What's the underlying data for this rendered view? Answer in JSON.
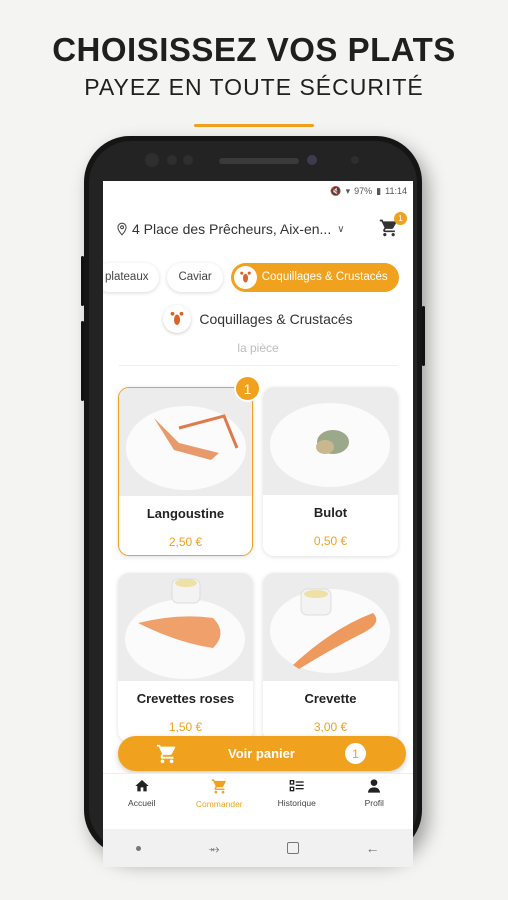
{
  "promo": {
    "headline": "CHOISISSEZ VOS PLATS",
    "subheadline": "PAYEZ EN TOUTE SÉCURITÉ"
  },
  "status_bar": {
    "battery": "97%",
    "time": "11:14"
  },
  "location": {
    "address": "4 Place des Prêcheurs, Aix-en...",
    "icon": "map-pin-icon"
  },
  "header_cart": {
    "count": "1",
    "icon": "cart-icon"
  },
  "categories": [
    {
      "label": "plateaux",
      "active": false
    },
    {
      "label": "Caviar",
      "active": false
    },
    {
      "label": "Coquillages & Crustacés",
      "active": true
    }
  ],
  "section": {
    "title": "Coquillages & Crustacés",
    "subtitle": "la pièce"
  },
  "products": [
    {
      "name": "Langoustine",
      "price": "2,50 €",
      "quantity": "1",
      "selected": true
    },
    {
      "name": "Bulot",
      "price": "0,50 €",
      "selected": false
    },
    {
      "name": "Crevettes roses",
      "price": "1,50 €",
      "selected": false
    },
    {
      "name": "Crevette",
      "price": "3,00 €",
      "selected": false
    }
  ],
  "cart_button": {
    "label": "Voir panier",
    "count": "1"
  },
  "bottom_nav": [
    {
      "label": "Accueil",
      "icon": "home-icon",
      "active": false
    },
    {
      "label": "Commander",
      "icon": "cart-icon",
      "active": true
    },
    {
      "label": "Historique",
      "icon": "list-icon",
      "active": false
    },
    {
      "label": "Profil",
      "icon": "person-icon",
      "active": false
    }
  ],
  "colors": {
    "accent": "#f0a21e",
    "background": "#f4f4f3"
  }
}
